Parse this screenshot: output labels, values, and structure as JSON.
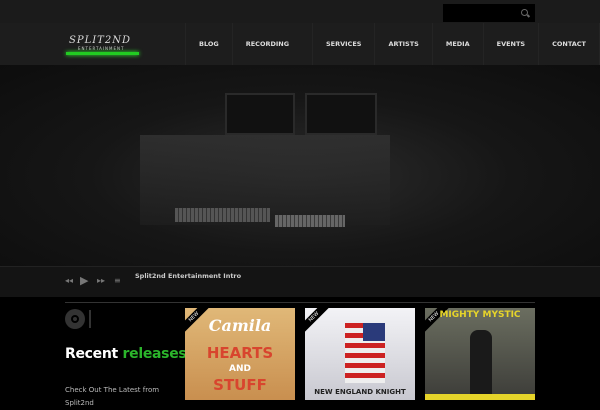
{
  "search": {
    "placeholder": ""
  },
  "logo": {
    "text": "SPLIT2ND",
    "sub": "ENTERTAINMENT"
  },
  "nav": [
    "BLOG",
    "RECORDING STUDIO",
    "SERVICES",
    "ARTISTS",
    "MEDIA",
    "EVENTS",
    "CONTACT"
  ],
  "player": {
    "title": "Split2nd Entertainment Intro"
  },
  "releases": {
    "title_a": "Recent",
    "title_b": "releases.",
    "desc": "Check Out The Latest from Split2nd",
    "badge": "NEW",
    "covers": [
      {
        "title": "Camila",
        "line1": "HEARTS",
        "line2": "AND",
        "line3": "STUFF"
      },
      {
        "title": "NEW ENGLAND KNIGHT"
      },
      {
        "title": "MIGHTY MYSTIC"
      }
    ]
  },
  "colors": {
    "accent": "#2bb52b"
  }
}
